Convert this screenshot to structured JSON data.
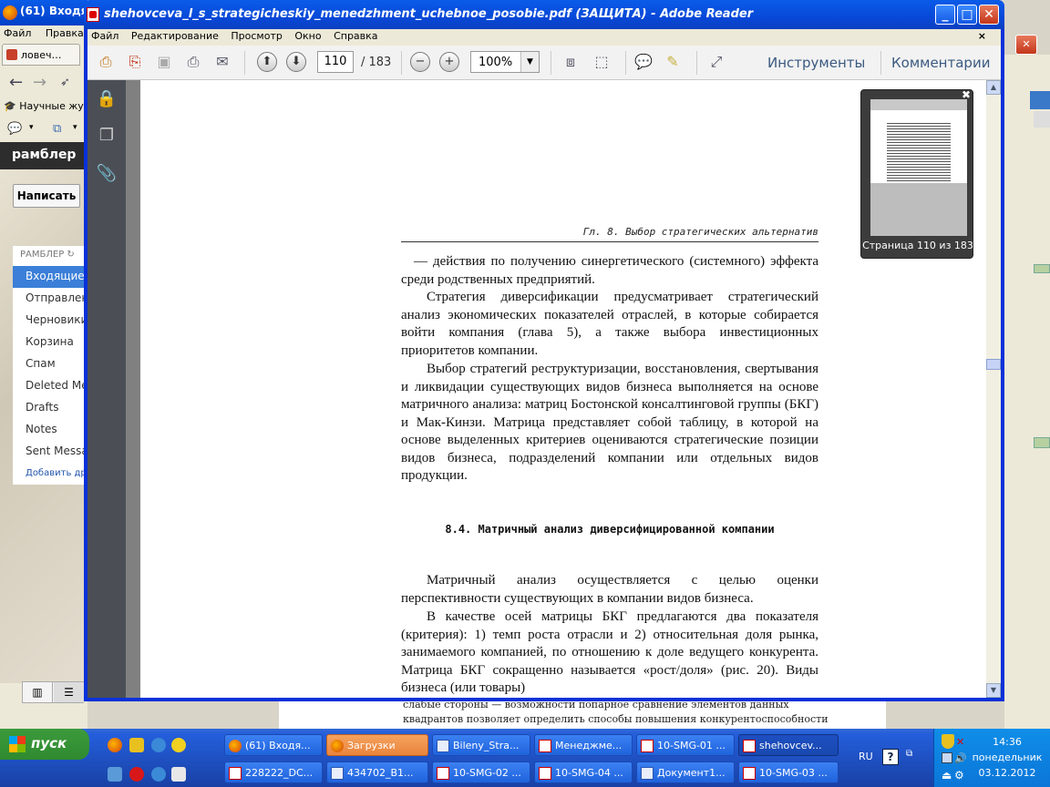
{
  "firefox": {
    "title": "(61) Входя",
    "menu": [
      "Файл",
      "Правка"
    ],
    "tab_label": "ловеч…",
    "bookmark": "Научные жур",
    "rambler_logo": "рамблер",
    "write_button": "Написать",
    "rambler_header": "РАМБЛЕР",
    "folders": [
      "Входящие",
      "Отправлен",
      "Черновики",
      "Корзина",
      "Спам",
      "Deleted Me",
      "Drafts",
      "Notes",
      "Sent Messa"
    ],
    "add_folder": "Добавить др"
  },
  "reader": {
    "title": "shehovceva_l_s_strategicheskiy_menedzhment_uchebnoe_posobie.pdf (ЗАЩИТА) - Adobe Reader",
    "menu": [
      "Файл",
      "Редактирование",
      "Просмотр",
      "Окно",
      "Справка"
    ],
    "page_current": "110",
    "page_total": "/ 183",
    "zoom": "100%",
    "tools_label": "Инструменты",
    "comments_label": "Комментарии",
    "thumbnail_caption": "Страница 110 из 183"
  },
  "document": {
    "running_head": "Гл. 8. Выбор стратегических альтернатив",
    "para1": "— действия по получению синергетического (системного) эффекта среди родственных предприятий.",
    "para2": "Стратегия диверсификации предусматривает стратегический анализ экономических показателей отраслей, в которые собирается войти компания (глава 5), а также выбора инвестиционных приоритетов компании.",
    "para3": "Выбор стратегий реструктуризации, восстановления, свертывания и ликвидации существующих видов бизнеса выполняется на основе матричного анализа: матриц Бостонской консалтинговой группы (БКГ) и Мак-Кинзи. Матрица представляет собой таблицу, в которой на основе выделенных критериев оцениваются стратегические позиции видов бизнеса, подразделений компании или отдельных видов продукции.",
    "section_heading": "8.4. Матричный анализ диверсифицированной компании",
    "para4": "Матричный анализ осуществляется с целью оценки перспективности существующих в компании видов бизнеса.",
    "para5": "В качестве осей матрицы БКГ предлагаются два показателя (критерия): 1) темп роста отрасли и 2) относительная доля рынка, занимаемого компанией, по отношению к доле ведущего конкурента. Матрица БКГ сокращенно называется «рост/доля» (рис. 20). Виды бизнеса (или товары)"
  },
  "background_doc": {
    "line1": "слабые стороны — возможности попарное сравнение элементов данных",
    "line2": "квадрантов позволяет определить способы повышения конкурентоспособности"
  },
  "taskbar": {
    "start": "пуск",
    "row1": [
      "(61) Входя...",
      "Загрузки",
      "Bileny_Stra...",
      "Менеджме...",
      "10-SMG-01 ...",
      "shehovcev..."
    ],
    "row2": [
      "228222_DC...",
      "434702_B1...",
      "10-SMG-02 ...",
      "10-SMG-04 ...",
      "Документ1...",
      "10-SMG-03 ..."
    ],
    "lang": "RU",
    "time": "14:36",
    "weekday": "понедельник",
    "date": "03.12.2012"
  }
}
